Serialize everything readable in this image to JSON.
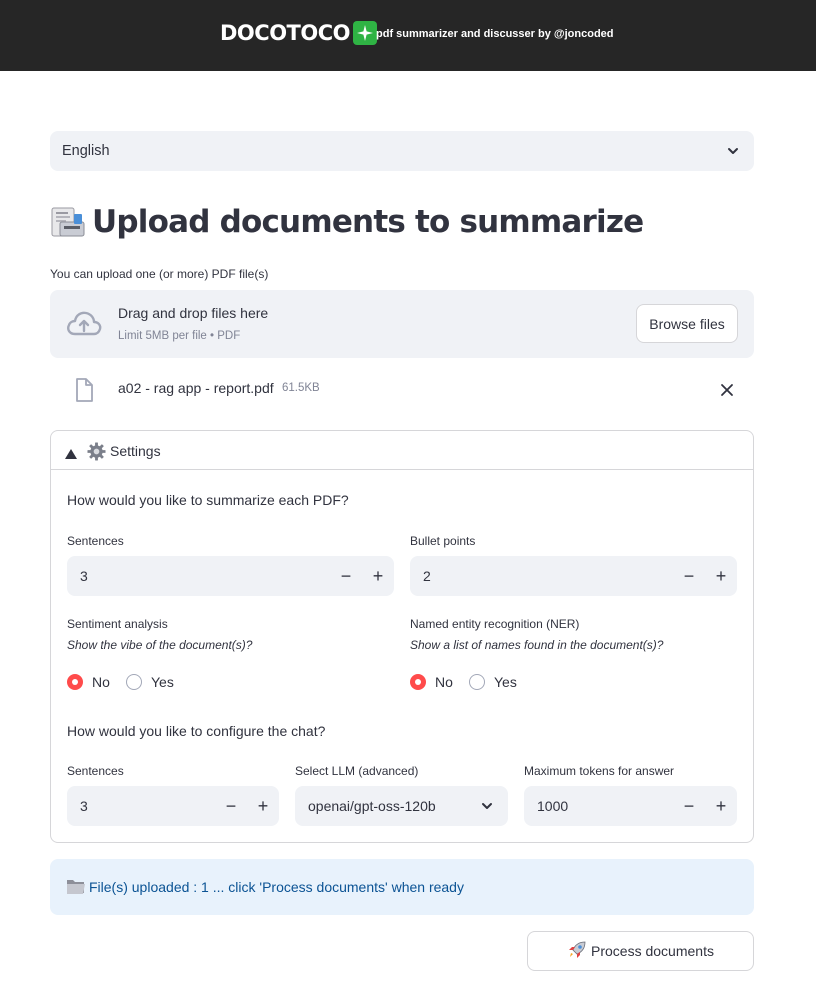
{
  "header": {
    "brand": "DOCOTOCO",
    "tagline": "pdf summarizer and discusser by @joncoded",
    "brand_icon": "sparkle-icon",
    "brand_icon_color": "#2fb344",
    "background_color": "#262626"
  },
  "language": {
    "selected": "English"
  },
  "upload": {
    "title": "Upload documents to summarize",
    "label": "You can upload one (or more) PDF file(s)",
    "drop_title": "Drag and drop files here",
    "drop_sub": "Limit 5MB per file • PDF",
    "browse_label": "Browse files",
    "files": [
      {
        "name": "a02 - rag app - report.pdf",
        "size": "61.5KB"
      }
    ]
  },
  "settings": {
    "title": "Settings",
    "summary_question": "How would you like to summarize each PDF?",
    "sentences": {
      "label": "Sentences",
      "value": "3"
    },
    "bullets": {
      "label": "Bullet points",
      "value": "2"
    },
    "sentiment": {
      "label": "Sentiment analysis",
      "hint": "Show the vibe of the document(s)?",
      "options": [
        "No",
        "Yes"
      ],
      "selected": "No"
    },
    "ner": {
      "label": "Named entity recognition (NER)",
      "hint": "Show a list of names found in the document(s)?",
      "options": [
        "No",
        "Yes"
      ],
      "selected": "No"
    },
    "chat_question": "How would you like to configure the chat?",
    "chat_sentences": {
      "label": "Sentences",
      "value": "3"
    },
    "llm": {
      "label": "Select LLM (advanced)",
      "value": "openai/gpt-oss-120b"
    },
    "max_tokens": {
      "label": "Maximum tokens for answer",
      "value": "1000"
    }
  },
  "status": {
    "message": "File(s) uploaded : 1 ... click 'Process documents' when ready",
    "color": "#0b5394"
  },
  "actions": {
    "process_label": "Process documents"
  },
  "colors": {
    "accent": "#ff4b4b",
    "input_bg": "#f0f2f6",
    "info_bg": "#e8f2fc"
  }
}
